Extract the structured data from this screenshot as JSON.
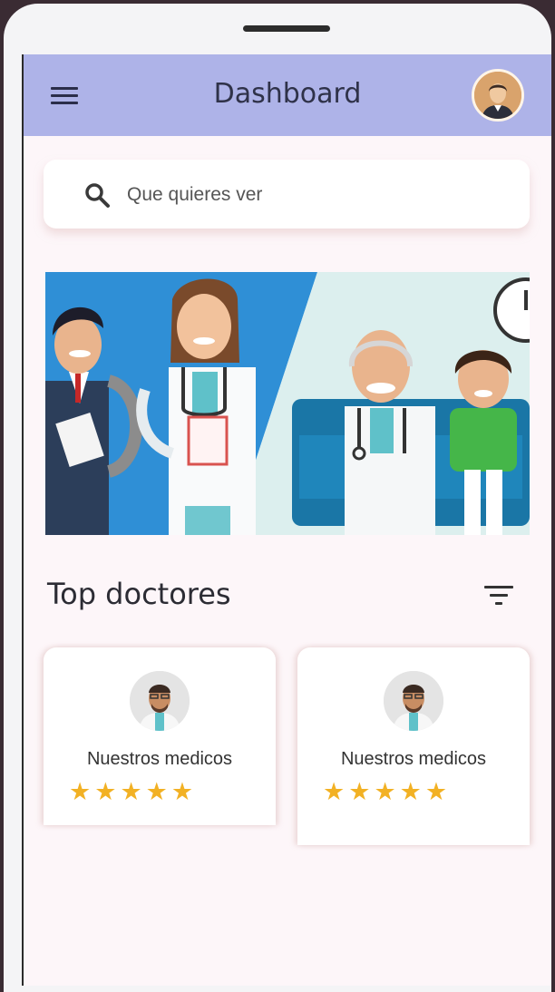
{
  "header": {
    "title": "Dashboard"
  },
  "search": {
    "placeholder": "Que quieres ver",
    "value": ""
  },
  "section": {
    "title": "Top doctores"
  },
  "doctors": [
    {
      "name": "Nuestros medicos",
      "rating": 5
    },
    {
      "name": "Nuestros medicos",
      "rating": 5
    }
  ],
  "colors": {
    "appbar": "#aeb3e8",
    "background": "#fdf6f9",
    "star": "#f2b124",
    "banner_blue": "#2f8fd6"
  },
  "icons": {
    "menu": "hamburger-menu-icon",
    "profile": "user-avatar",
    "search": "search-icon",
    "filter": "filter-icon",
    "star": "star-icon"
  }
}
